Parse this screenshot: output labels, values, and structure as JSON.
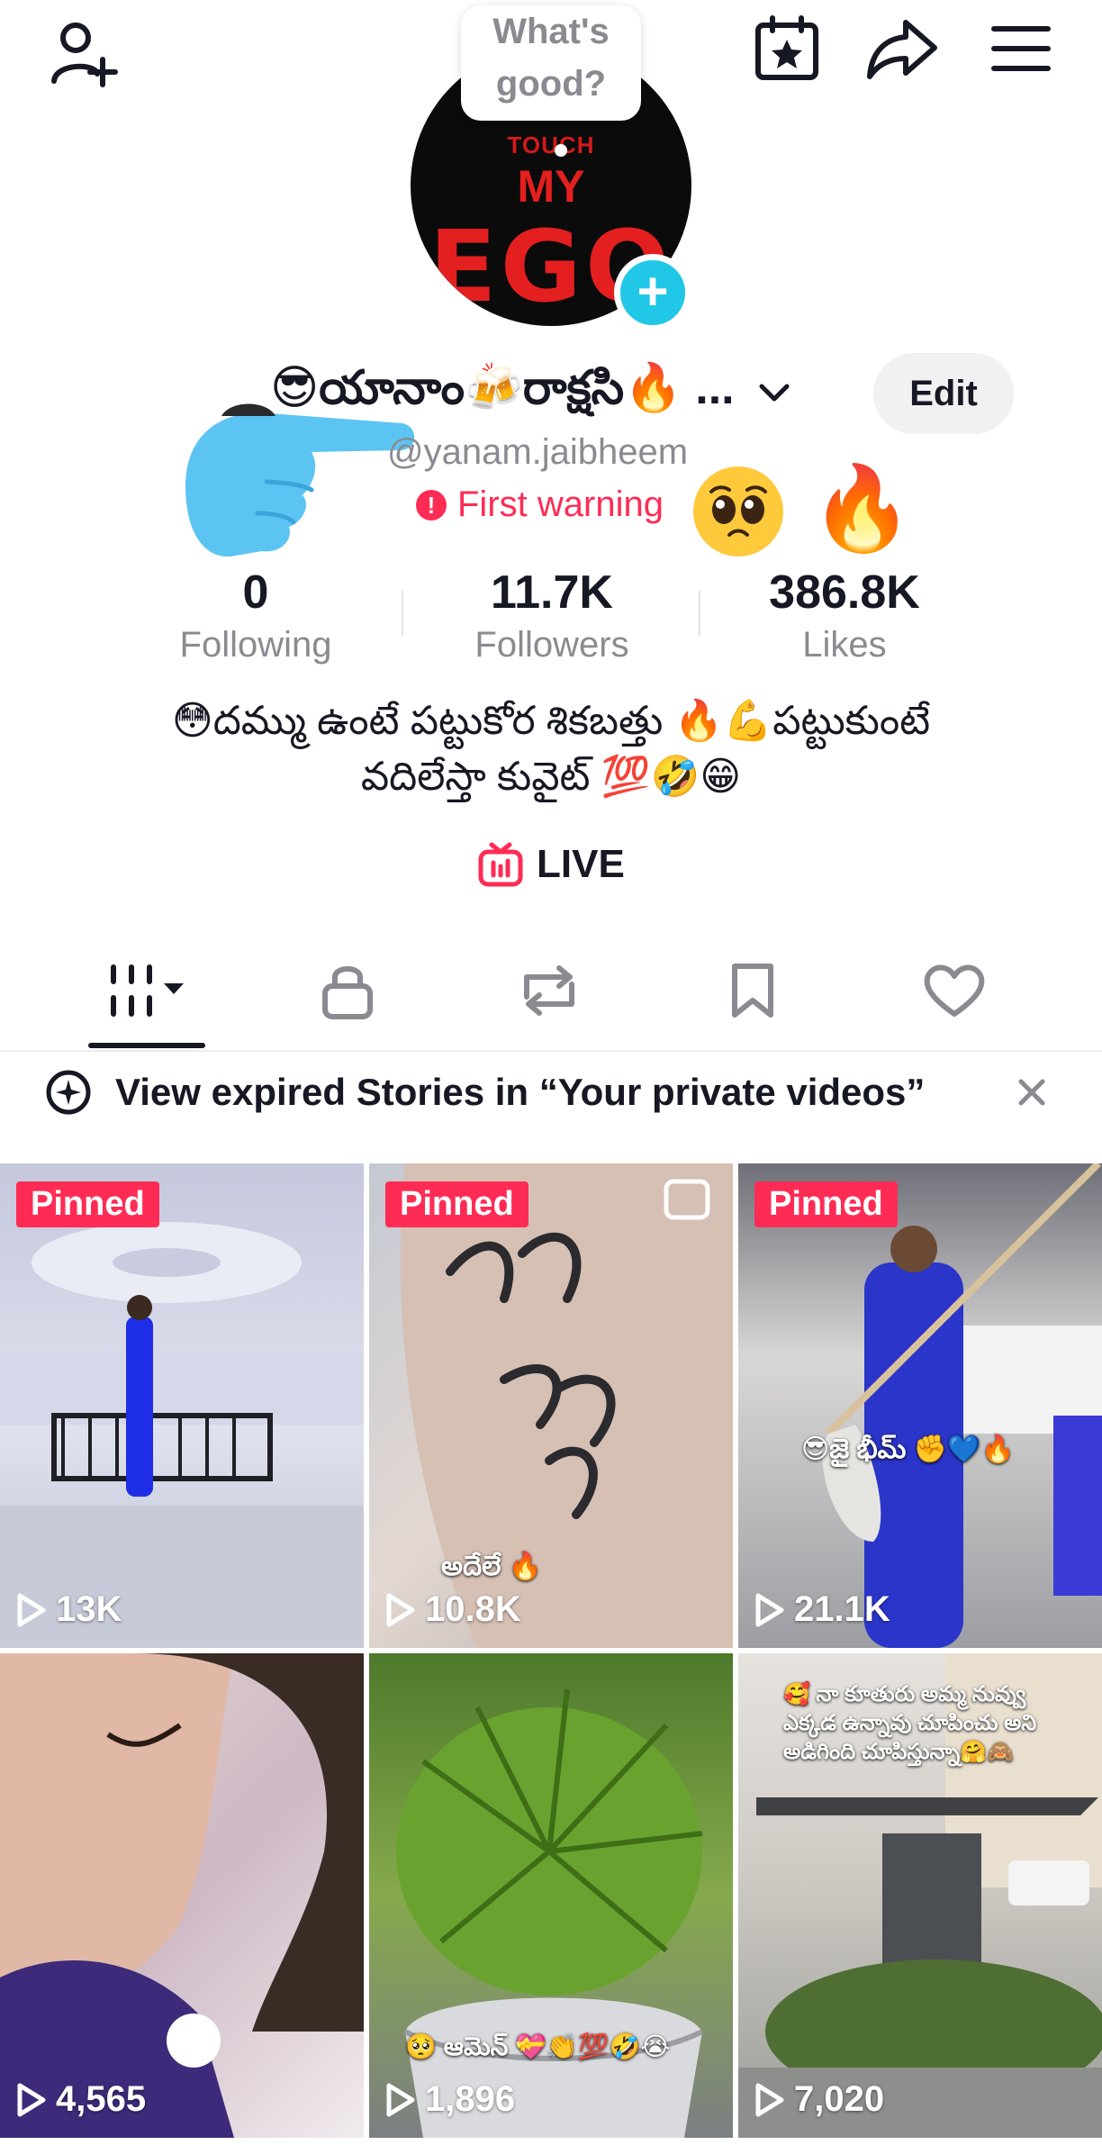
{
  "top_bar": {
    "add_friend_icon": "person-plus-icon",
    "calendar_icon": "calendar-star-icon",
    "share_icon": "share-arrow-icon",
    "menu_icon": "hamburger-menu-icon"
  },
  "avatar": {
    "note_bubble": "What's good?",
    "image_text_small": "TOUCH",
    "image_text_my": "MY",
    "image_text_ego": "EGO"
  },
  "profile": {
    "display_name": "😎యానాం🍻రాక్షసి🔥 ...",
    "edit_label": "Edit",
    "username": "@yanam.jaibheem",
    "warning_text": "First warning",
    "warning_badge": "!",
    "fire_emoji": "🔥"
  },
  "stats": [
    {
      "value": "0",
      "label": "Following"
    },
    {
      "value": "11.7K",
      "label": "Followers"
    },
    {
      "value": "386.8K",
      "label": "Likes"
    }
  ],
  "bio": {
    "line1": "😳దమ్ము ఉంటే పట్టుకోర శికబత్తు 🔥💪పట్టుకుంటే",
    "line2": "వదిలేస్తా కువైట్ 💯🤣😁"
  },
  "live": {
    "label": "LIVE"
  },
  "tabs": [
    {
      "name": "videos",
      "icon": "grid-dropdown-icon",
      "active": true
    },
    {
      "name": "private",
      "icon": "lock-icon"
    },
    {
      "name": "reposts",
      "icon": "repost-icon"
    },
    {
      "name": "favorites",
      "icon": "bookmark-icon"
    },
    {
      "name": "liked",
      "icon": "heart-icon"
    }
  ],
  "notice": {
    "text": "View expired Stories in “Your private videos”",
    "close_icon": "close-icon"
  },
  "videos": [
    {
      "views": "13K",
      "pinned": "Pinned"
    },
    {
      "views": "10.8K",
      "pinned": "Pinned",
      "overlay": "అదేలే 🔥"
    },
    {
      "views": "21.1K",
      "pinned": "Pinned",
      "overlay": "😎జై భీమ్ ✊💙🔥"
    },
    {
      "views": "4,565"
    },
    {
      "views": "1,896",
      "overlay": "🥺 ఆమెన్ 💝👏💯🤣😭"
    },
    {
      "views": "7,020",
      "overlay": "🥰 నా కూతురు అమ్మ నువ్వు ఎక్కడ ఉన్నావు చూపించు అని అడిగింది చూపిస్తున్నా🤗🙈"
    }
  ],
  "colors": {
    "accent": "#fe2c55",
    "text": "#161823",
    "muted": "#8a8b91",
    "badge": "#20c7e6"
  }
}
